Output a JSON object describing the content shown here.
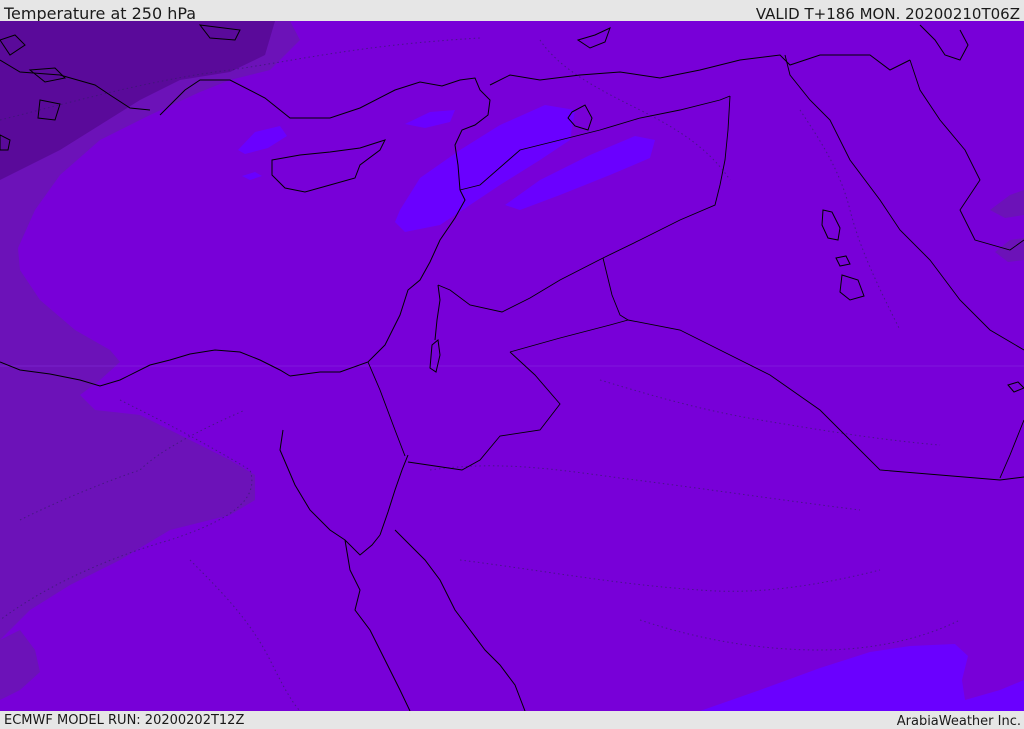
{
  "header": {
    "title": "Temperature at 250 hPa",
    "valid_time": "VALID T+186 MON. 20200210T06Z"
  },
  "footer": {
    "model_run": "ECMWF MODEL RUN: 20200202T12Z",
    "credit": "ArabiaWeather Inc."
  },
  "map": {
    "field": "temperature",
    "level": "250 hPa",
    "colors": {
      "base": "#7800d8",
      "darker": "#6c12b8",
      "darkest": "#5a0a9a",
      "warm_patch": "#6a00ff",
      "coastline": "#000000"
    },
    "icons": [
      "coastline",
      "country-border",
      "contour-line"
    ]
  }
}
